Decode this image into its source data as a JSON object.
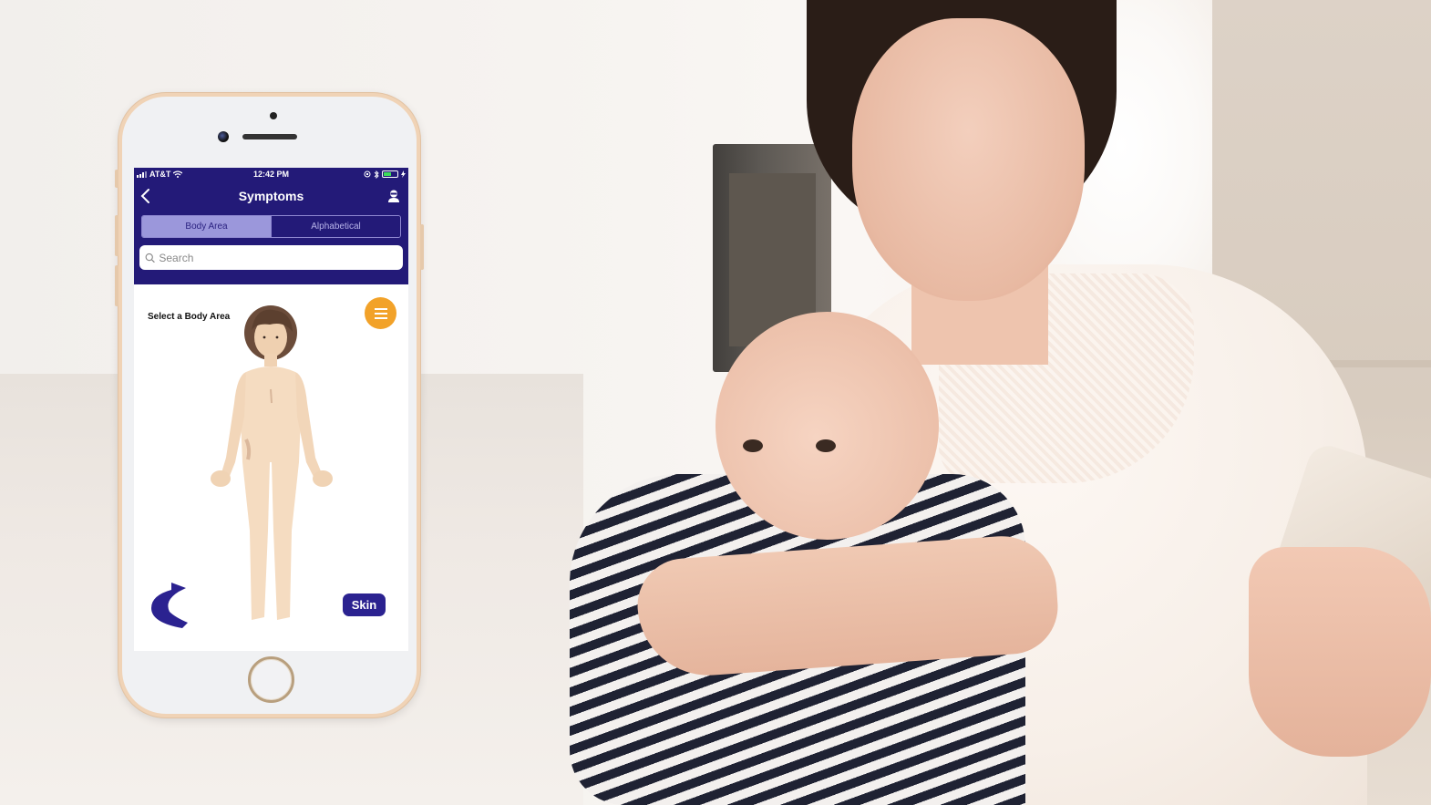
{
  "phone": {
    "status_bar": {
      "carrier": "AT&T",
      "time": "12:42 PM",
      "battery_level": 0.6
    },
    "nav": {
      "title": "Symptoms",
      "back_icon": "chevron-left-icon",
      "profile_icon": "person-icon"
    },
    "tabs": [
      {
        "label": "Body Area",
        "active": true
      },
      {
        "label": "Alphabetical",
        "active": false
      }
    ],
    "search": {
      "placeholder": "Search",
      "value": ""
    },
    "content": {
      "prompt": "Select a Body Area",
      "menu_icon": "hamburger-menu-icon",
      "rotate_icon": "rotate-arrow-icon",
      "skin_button": "Skin"
    }
  },
  "colors": {
    "header": "#231a78",
    "active_tab": "#9b97db",
    "fab": "#f2a229",
    "skin_button": "#2b2290",
    "phone_frame": "#f0d3b6"
  }
}
